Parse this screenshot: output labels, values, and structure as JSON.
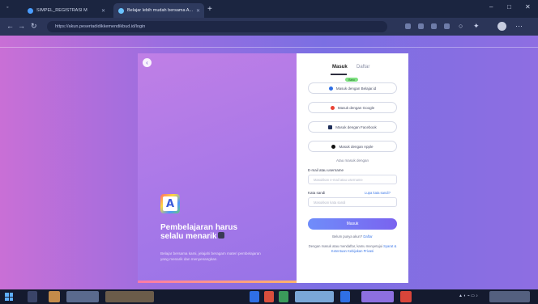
{
  "browser": {
    "tabs": [
      {
        "title": "SIMPEL_REGISTRASI M",
        "favicon_color": "#4a9dff"
      },
      {
        "title": "Belajar lebih mudah bersama A...",
        "favicon_color": "#6ac3ff"
      }
    ],
    "new_tab_label": "+",
    "url": "https://akun.pesertadidikkemendikbud.id/login",
    "window": {
      "minimize": "–",
      "maximize": "□",
      "close": "✕"
    }
  },
  "hero": {
    "title_line1": "Pembelajaran harus",
    "title_line2": "selalu menarik",
    "description": "Belajar bersama kami, jelajahi beragam materi pembelajaran yang menarik dan menyenangkan.",
    "logo_letter": "A"
  },
  "login": {
    "tab_login": "Masuk",
    "tab_register": "Daftar",
    "new_badge": "Baru",
    "sso_buttons": [
      {
        "label": "Masuk dengan Belajar.id",
        "icon_color": "#2f6fe4"
      },
      {
        "label": "Masuk dengan Google",
        "icon_color": "#ea4335"
      },
      {
        "label": "Masuk dengan Facebook",
        "icon_color": "#1f2f5a"
      },
      {
        "label": "Masuk dengan Apple",
        "icon_color": "#111111"
      }
    ],
    "or_text": "Atau masuk dengan",
    "email_label": "E-mail atau username",
    "email_placeholder": "Masukkan e-mail atau username",
    "password_label": "Kata sandi",
    "forgot_label": "Lupa kata sandi?",
    "password_placeholder": "Masukkan kata sandi",
    "submit_label": "Masuk",
    "register_prompt": "Belum punya akun?",
    "register_link": "Daftar",
    "terms_text": "Dengan masuk atau mendaftar, kamu menyetujui",
    "terms_link": "Syarat & Ketentuan",
    "privacy_link": "Kebijakan Privasi"
  },
  "accent_colors": {
    "primary_button": "#6f8dfa",
    "link": "#3f7ae8",
    "background_left": "#c96fd6",
    "background_right": "#7b6fe3"
  }
}
